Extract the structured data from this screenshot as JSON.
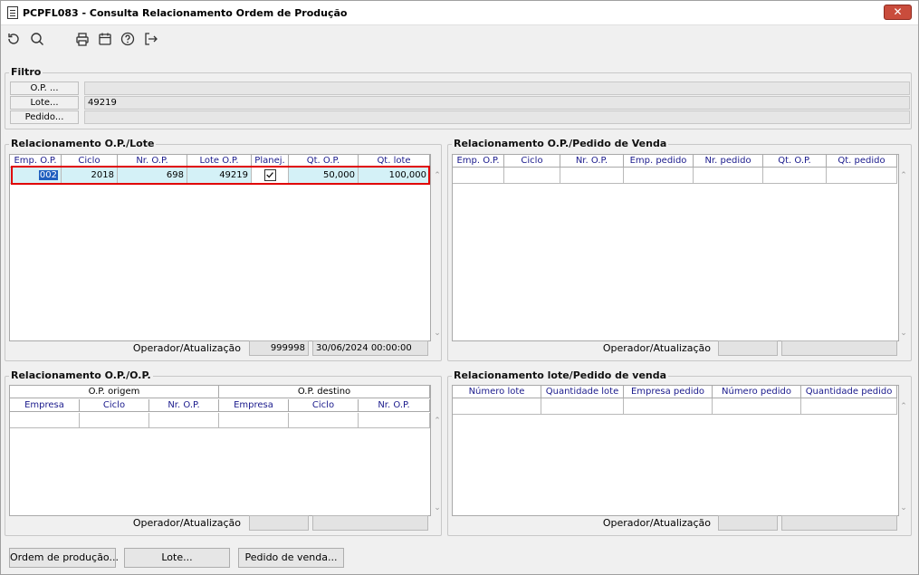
{
  "window": {
    "title": "PCPFL083 - Consulta Relacionamento Ordem de Produção",
    "close_label": "✕"
  },
  "toolbar": {
    "icons": [
      "refresh-icon",
      "search-icon",
      "print-icon",
      "calendar-icon",
      "help-icon",
      "exit-icon"
    ]
  },
  "filtro": {
    "title": "Filtro",
    "op_label": "O.P. ...",
    "op_value": "",
    "lote_label": "Lote...",
    "lote_value": "49219",
    "pedido_label": "Pedido...",
    "pedido_value": ""
  },
  "op_lote": {
    "title": "Relacionamento O.P./Lote",
    "columns": [
      "Emp. O.P.",
      "Ciclo",
      "Nr. O.P.",
      "Lote O.P.",
      "Planej.",
      "Qt. O.P.",
      "Qt. lote"
    ],
    "rows": [
      {
        "emp": "002",
        "ciclo": "2018",
        "nr_op": "698",
        "lote": "49219",
        "planej": true,
        "qt_op": "50,000",
        "qt_lote": "100,000"
      }
    ],
    "operador_label": "Operador/Atualização",
    "operador": "999998",
    "atualizacao": "30/06/2024 00:00:00"
  },
  "op_pedido": {
    "title": "Relacionamento O.P./Pedido de Venda",
    "columns": [
      "Emp. O.P.",
      "Ciclo",
      "Nr. O.P.",
      "Emp. pedido",
      "Nr. pedido",
      "Qt. O.P.",
      "Qt. pedido"
    ],
    "operador_label": "Operador/Atualização",
    "operador": "",
    "atualizacao": ""
  },
  "op_op": {
    "title": "Relacionamento O.P./O.P.",
    "group_origem": "O.P. origem",
    "group_destino": "O.P. destino",
    "columns": [
      "Empresa",
      "Ciclo",
      "Nr. O.P.",
      "Empresa",
      "Ciclo",
      "Nr. O.P."
    ],
    "operador_label": "Operador/Atualização",
    "operador": "",
    "atualizacao": ""
  },
  "lote_pedido": {
    "title": "Relacionamento lote/Pedido de venda",
    "columns": [
      "Número lote",
      "Quantidade lote",
      "Empresa pedido",
      "Número pedido",
      "Quantidade pedido"
    ],
    "operador_label": "Operador/Atualização",
    "operador": "",
    "atualizacao": ""
  },
  "buttons": {
    "ordem": "Ordem de produção...",
    "lote": "Lote...",
    "pedido": "Pedido de venda..."
  },
  "colors": {
    "highlight_border": "#e00000",
    "header_text": "#1a1a8c",
    "row_bg": "#d4f1f7",
    "selected_cell": "#1f5fbf"
  }
}
